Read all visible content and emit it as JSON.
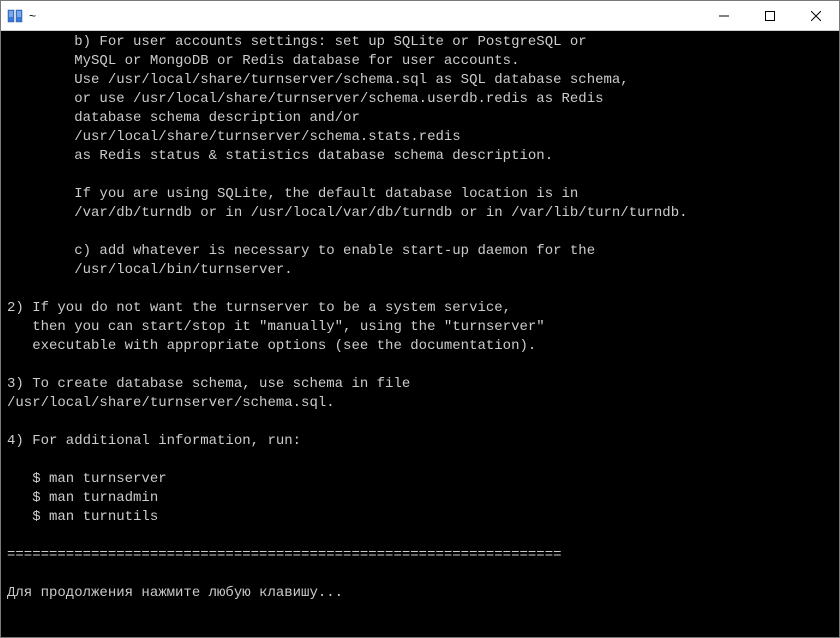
{
  "window": {
    "title": "~"
  },
  "terminal": {
    "lines": [
      "        b) For user accounts settings: set up SQLite or PostgreSQL or",
      "        MySQL or MongoDB or Redis database for user accounts.",
      "        Use /usr/local/share/turnserver/schema.sql as SQL database schema,",
      "        or use /usr/local/share/turnserver/schema.userdb.redis as Redis",
      "        database schema description and/or",
      "        /usr/local/share/turnserver/schema.stats.redis",
      "        as Redis status & statistics database schema description.",
      "",
      "        If you are using SQLite, the default database location is in",
      "        /var/db/turndb or in /usr/local/var/db/turndb or in /var/lib/turn/turndb.",
      "",
      "        c) add whatever is necessary to enable start-up daemon for the",
      "        /usr/local/bin/turnserver.",
      "",
      "2) If you do not want the turnserver to be a system service,",
      "   then you can start/stop it \"manually\", using the \"turnserver\"",
      "   executable with appropriate options (see the documentation).",
      "",
      "3) To create database schema, use schema in file",
      "/usr/local/share/turnserver/schema.sql.",
      "",
      "4) For additional information, run:",
      "",
      "   $ man turnserver",
      "   $ man turnadmin",
      "   $ man turnutils",
      "",
      "==================================================================",
      "",
      "Для продолжения нажмите любую клавишу..."
    ]
  }
}
